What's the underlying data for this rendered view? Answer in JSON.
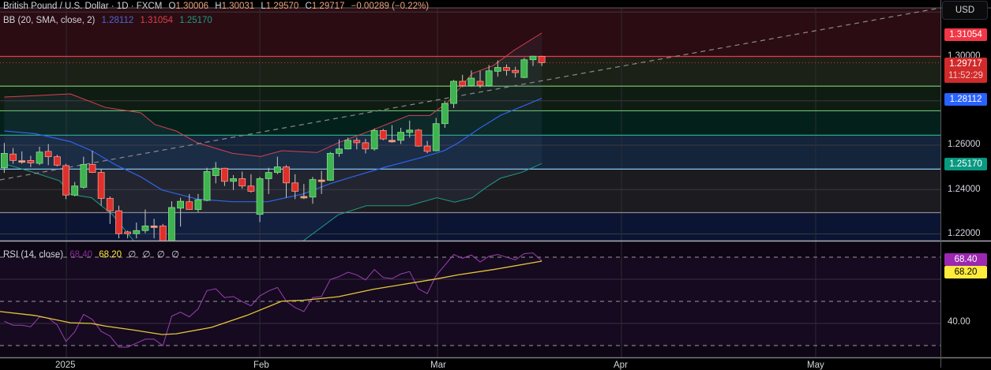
{
  "header": {
    "title": "British Pound / U.S. Dollar · 1D · FXCM",
    "open_label": "O",
    "open": "1.30006",
    "high_label": "H",
    "high": "1.30031",
    "low_label": "L",
    "low": "1.29570",
    "close_label": "C",
    "close": "1.29717",
    "change": "−0.00289 (−0.22%)"
  },
  "bb_legend": {
    "name": "BB (20, SMA, close, 2)",
    "basis": "1.28112",
    "upper": "1.31054",
    "lower": "1.25170"
  },
  "rsi_legend": {
    "name": "RSI (14, close)",
    "rsi": "68.40",
    "ma": "68.20",
    "empty": [
      "∅",
      "∅",
      "∅",
      "∅"
    ]
  },
  "price_axis": {
    "currency": "USD",
    "labels": [
      "1.30000",
      "1.26000",
      "1.24000",
      "1.22000"
    ],
    "upper_badge": "1.31054",
    "last_price": "1.29717",
    "countdown": "11:52:29",
    "basis_badge": "1.28112",
    "lower_badge": "1.25170"
  },
  "rsi_axis": {
    "rsi_badge": "68.40",
    "ma_badge": "68.20",
    "labels": [
      "40.00"
    ]
  },
  "time_axis": [
    "2025",
    "Feb",
    "Mar",
    "Apr",
    "May"
  ],
  "colors": {
    "up": "#3fb34f",
    "down": "#e0302c",
    "bb_upper": "#d8404f",
    "bb_basis": "#2f63e8",
    "bb_lower": "#1f9a84",
    "rsi": "#9c3fb5",
    "rsi_ma": "#e8c53a",
    "accent_red": "#f23645",
    "accent_blue": "#2962ff",
    "accent_teal": "#089981",
    "rsi_purple": "#9c27b0",
    "rsi_yellow": "#ffeb3b"
  },
  "chart_data": {
    "type": "candlestick",
    "symbol": "GBPUSD",
    "interval": "1D",
    "ylim": [
      1.2165,
      1.3265
    ],
    "candles": [
      [
        1.2498,
        1.261,
        1.2475,
        1.2563
      ],
      [
        1.256,
        1.2587,
        1.2516,
        1.2531
      ],
      [
        1.253,
        1.2572,
        1.2516,
        1.253
      ],
      [
        1.2531,
        1.2552,
        1.2501,
        1.252
      ],
      [
        1.2518,
        1.2593,
        1.251,
        1.2569
      ],
      [
        1.2572,
        1.2605,
        1.251,
        1.2548
      ],
      [
        1.2548,
        1.2557,
        1.2504,
        1.251
      ],
      [
        1.2508,
        1.2516,
        1.2357,
        1.2375
      ],
      [
        1.2375,
        1.2434,
        1.2369,
        1.2416
      ],
      [
        1.241,
        1.2548,
        1.2404,
        1.2513
      ],
      [
        1.2513,
        1.2575,
        1.2475,
        1.2477
      ],
      [
        1.2477,
        1.2493,
        1.2327,
        1.236
      ],
      [
        1.236,
        1.2369,
        1.2245,
        1.2304
      ],
      [
        1.2304,
        1.2327,
        1.218,
        1.2201
      ],
      [
        1.2209,
        1.2215,
        1.218,
        1.2201
      ],
      [
        1.2201,
        1.2251,
        1.218,
        1.2215
      ],
      [
        1.2215,
        1.231,
        1.2203,
        1.2236
      ],
      [
        1.2236,
        1.2268,
        1.218,
        1.2236
      ],
      [
        1.2236,
        1.2245,
        1.216,
        1.2168
      ],
      [
        1.2168,
        1.2347,
        1.216,
        1.2319
      ],
      [
        1.2316,
        1.2363,
        1.2233,
        1.2347
      ],
      [
        1.2345,
        1.238,
        1.231,
        1.231
      ],
      [
        1.231,
        1.238,
        1.2298,
        1.2354
      ],
      [
        1.2351,
        1.2498,
        1.2347,
        1.2481
      ],
      [
        1.2463,
        1.2524,
        1.2428,
        1.2496
      ],
      [
        1.2496,
        1.2498,
        1.2416,
        1.2437
      ],
      [
        1.2437,
        1.2465,
        1.2398,
        1.2449
      ],
      [
        1.2449,
        1.2481,
        1.2404,
        1.2416
      ],
      [
        1.2416,
        1.2469,
        1.2386,
        1.2392
      ],
      [
        1.2288,
        1.2457,
        1.2253,
        1.2449
      ],
      [
        1.2449,
        1.2498,
        1.238,
        1.2477
      ],
      [
        1.2477,
        1.2548,
        1.2469,
        1.2502
      ],
      [
        1.2502,
        1.251,
        1.2363,
        1.243
      ],
      [
        1.243,
        1.2469,
        1.2357,
        1.2392
      ],
      [
        1.2369,
        1.2425,
        1.2357,
        1.2369
      ],
      [
        1.2366,
        1.2457,
        1.2336,
        1.2445
      ],
      [
        1.2443,
        1.2484,
        1.238,
        1.2443
      ],
      [
        1.2442,
        1.2569,
        1.2439,
        1.2563
      ],
      [
        1.2563,
        1.2626,
        1.2548,
        1.2583
      ],
      [
        1.2583,
        1.2634,
        1.2581,
        1.2622
      ],
      [
        1.2622,
        1.2634,
        1.2581,
        1.2611
      ],
      [
        1.2611,
        1.2628,
        1.2563,
        1.2583
      ],
      [
        1.2583,
        1.2675,
        1.2575,
        1.2666
      ],
      [
        1.2666,
        1.2673,
        1.2622,
        1.2628
      ],
      [
        1.2622,
        1.269,
        1.2611,
        1.2622
      ],
      [
        1.2622,
        1.2678,
        1.2605,
        1.2658
      ],
      [
        1.2657,
        1.2711,
        1.2634,
        1.2668
      ],
      [
        1.2668,
        1.2673,
        1.2593,
        1.2596
      ],
      [
        1.2596,
        1.2619,
        1.2563,
        1.2572
      ],
      [
        1.2575,
        1.2723,
        1.2572,
        1.2697
      ],
      [
        1.2697,
        1.2799,
        1.2678,
        1.2788
      ],
      [
        1.2788,
        1.2894,
        1.2767,
        1.2888
      ],
      [
        1.2888,
        1.2917,
        1.2862,
        1.2868
      ],
      [
        1.2868,
        1.2937,
        1.2864,
        1.2902
      ],
      [
        1.2888,
        1.2935,
        1.2858,
        1.287
      ],
      [
        1.2868,
        1.2961,
        1.2864,
        1.2935
      ],
      [
        1.2933,
        1.2982,
        1.2909,
        1.295
      ],
      [
        1.295,
        1.2964,
        1.2914,
        1.2937
      ],
      [
        1.2937,
        1.2953,
        1.2905,
        1.2927
      ],
      [
        1.2905,
        1.2994,
        1.2902,
        1.2985
      ],
      [
        1.2985,
        1.3003,
        1.2957,
        1.3001
      ],
      [
        1.30006,
        1.30031,
        1.2957,
        1.29717
      ]
    ],
    "bb_upper": [
      [
        0,
        1.2817
      ],
      [
        3.5,
        1.2823
      ],
      [
        7.5,
        1.2831
      ],
      [
        11.5,
        1.277
      ],
      [
        15.5,
        1.2746
      ],
      [
        17.1,
        1.2693
      ],
      [
        19.5,
        1.2664
      ],
      [
        21.9,
        1.2611
      ],
      [
        25.9,
        1.2563
      ],
      [
        29.1,
        1.2549
      ],
      [
        31.5,
        1.2575
      ],
      [
        35.5,
        1.2567
      ],
      [
        37.9,
        1.2611
      ],
      [
        41.9,
        1.267
      ],
      [
        45.9,
        1.2734
      ],
      [
        48.3,
        1.2734
      ],
      [
        50.3,
        1.2793
      ],
      [
        53.1,
        1.2923
      ],
      [
        55.5,
        1.2959
      ],
      [
        57.9,
        1.3029
      ],
      [
        61,
        1.31054
      ]
    ],
    "bb_basis": [
      [
        0,
        1.2664
      ],
      [
        3.5,
        1.2652
      ],
      [
        7.5,
        1.2616
      ],
      [
        9.9,
        1.2575
      ],
      [
        12.7,
        1.251
      ],
      [
        15.5,
        1.2457
      ],
      [
        17.9,
        1.2398
      ],
      [
        21.9,
        1.2357
      ],
      [
        25.9,
        1.2345
      ],
      [
        29.9,
        1.2345
      ],
      [
        33.9,
        1.238
      ],
      [
        37.1,
        1.2428
      ],
      [
        39.5,
        1.2457
      ],
      [
        43.5,
        1.2504
      ],
      [
        47.5,
        1.2546
      ],
      [
        49.9,
        1.2575
      ],
      [
        51.5,
        1.261
      ],
      [
        53.9,
        1.2675
      ],
      [
        56.3,
        1.2734
      ],
      [
        61,
        1.28112
      ]
    ],
    "bb_lower": [
      [
        0,
        1.2516
      ],
      [
        3.5,
        1.2475
      ],
      [
        6.3,
        1.2439
      ],
      [
        7.5,
        1.2378
      ],
      [
        9.9,
        1.2363
      ],
      [
        12.3,
        1.2286
      ],
      [
        14.7,
        1.2168
      ],
      [
        18,
        1.212
      ],
      [
        24,
        1.206
      ],
      [
        30,
        1.208
      ],
      [
        33.9,
        1.2168
      ],
      [
        37.9,
        1.2286
      ],
      [
        41.1,
        1.2327
      ],
      [
        45.9,
        1.2327
      ],
      [
        49.1,
        1.2363
      ],
      [
        51.1,
        1.2343
      ],
      [
        53.1,
        1.2363
      ],
      [
        54.7,
        1.241
      ],
      [
        56.3,
        1.2451
      ],
      [
        58.7,
        1.2477
      ],
      [
        61,
        1.2517
      ]
    ],
    "levels": [
      1.3,
      1.2866,
      1.2755,
      1.2645,
      1.2492,
      1.2296
    ],
    "rsi": [
      41.0,
      39.2,
      39.2,
      38.5,
      43.0,
      42.4,
      39.4,
      31.9,
      36.2,
      44.1,
      41.8,
      36.4,
      34.3,
      29.3,
      29.3,
      31.1,
      32.9,
      32.9,
      29.9,
      43.3,
      45.1,
      43.0,
      46.6,
      54.9,
      55.7,
      51.7,
      52.2,
      49.9,
      48.0,
      52.5,
      54.7,
      56.3,
      50.1,
      47.2,
      45.4,
      51.7,
      52.2,
      59.9,
      61.2,
      63.2,
      62.0,
      59.7,
      64.4,
      60.8,
      60.3,
      62.4,
      63.5,
      55.7,
      53.5,
      61.7,
      66.4,
      71.2,
      69.5,
      71.0,
      67.8,
      70.4,
      71.2,
      70.0,
      68.8,
      71.6,
      71.9,
      68.4
    ],
    "rsi_ma": [
      [
        -0.5,
        45.4
      ],
      [
        3.5,
        43.6
      ],
      [
        7.5,
        40.3
      ],
      [
        9.9,
        40.0
      ],
      [
        11.5,
        38.8
      ],
      [
        14.7,
        37.0
      ],
      [
        17.9,
        35.0
      ],
      [
        19.5,
        35.3
      ],
      [
        23.5,
        38.2
      ],
      [
        27.5,
        43.6
      ],
      [
        31.5,
        50.1
      ],
      [
        33.9,
        50.5
      ],
      [
        37.9,
        52.1
      ],
      [
        41.9,
        55.5
      ],
      [
        45.9,
        58.1
      ],
      [
        49.1,
        60.2
      ],
      [
        51.5,
        62.0
      ],
      [
        55.5,
        64.4
      ],
      [
        61,
        68.2
      ]
    ],
    "rsi_levels": [
      70,
      50,
      30
    ]
  }
}
